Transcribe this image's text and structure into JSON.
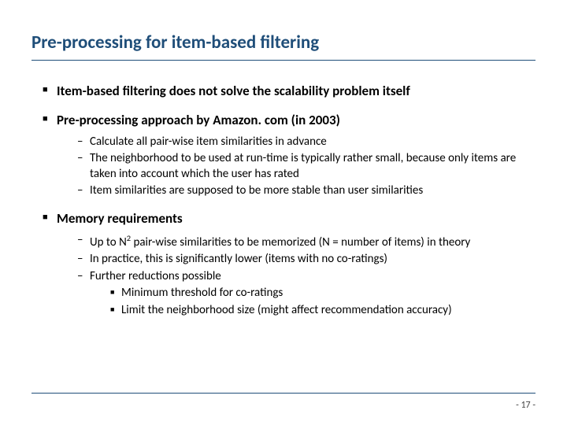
{
  "title": "Pre-processing for item-based filtering",
  "bullets": {
    "b1": "Item-based filtering does not solve the scalability problem itself",
    "b2": "Pre-processing approach by Amazon. com (in 2003)",
    "b2_sub": {
      "s1": "Calculate all pair-wise item similarities in advance",
      "s2": "The neighborhood to be used at run-time is typically rather small, because only items are taken into account which the user has rated",
      "s3": "Item similarities are supposed to be more stable than user similarities"
    },
    "b3": "Memory requirements",
    "b3_sub": {
      "s1_pre": "Up to N",
      "s1_sup": "2",
      "s1_post": " pair-wise similarities to be memorized (N = number of items) in theory",
      "s2": "In practice, this is significantly lower (items with no co-ratings)",
      "s3": "Further reductions possible",
      "s3_sub": {
        "ss1": "Minimum threshold for co-ratings",
        "ss2": "Limit the neighborhood size (might affect recommendation accuracy)"
      }
    }
  },
  "page": "- 17 -"
}
